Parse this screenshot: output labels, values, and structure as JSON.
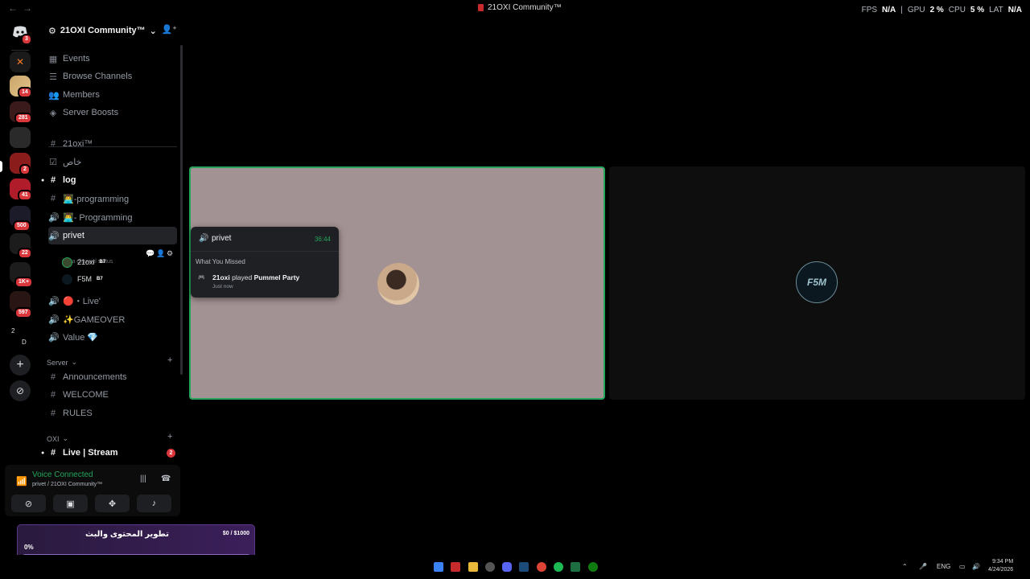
{
  "window": {
    "title": "21OXI Community™",
    "back": "←",
    "forward": "→"
  },
  "perf": {
    "fps_label": "FPS",
    "fps_value": "N/A",
    "gpu_label": "GPU",
    "gpu_value": "2 %",
    "cpu_label": "CPU",
    "cpu_value": "5 %",
    "lat_label": "LAT",
    "lat_value": "N/A"
  },
  "rail": {
    "home_badge": "3",
    "badges": [
      "14",
      "281",
      "2",
      "41",
      "500",
      "22",
      "1K+",
      "597"
    ],
    "folder_labels": [
      "2",
      "D"
    ]
  },
  "server": {
    "name": "21OXI Community™",
    "menu_items": [
      "Events",
      "Browse Channels",
      "Members",
      "Server Boosts"
    ]
  },
  "channels": {
    "c1": "21oxi™",
    "c2": "خاص",
    "c3": "log",
    "c4": "👨‍💻-programming",
    "c5": "👨‍💻- Programming",
    "c6": "privet",
    "c6_status": "Set a channel status",
    "members": [
      {
        "name": "21oxi",
        "tag": "B7"
      },
      {
        "name": "F5M",
        "tag": "B7"
      }
    ],
    "c7": "🔴・Live'",
    "c8": "✨GAMEOVER",
    "c9": "Value 💎",
    "cat1": "Server",
    "c10": "Announcements",
    "c11": "WELCOME",
    "c12": "RULES",
    "cat2": "OXI",
    "c13": "Live | Stream",
    "c13_badge": "2"
  },
  "voice": {
    "status": "Voice Connected",
    "location": "privet / 21OXI Community™"
  },
  "popover": {
    "channel": "privet",
    "time": "36:44",
    "heading": "What You Missed",
    "user": "21oxi",
    "action": "played",
    "game": "Pummel Party",
    "when": "Just now"
  },
  "tiles": {
    "second_avatar_text": "F5M"
  },
  "goal": {
    "title": "تطوير المحتوى والبث",
    "amount": "$0 / $1000",
    "percent_label": "0%",
    "progress": 0
  },
  "taskbar": {
    "lang": "ENG",
    "time": "9:34 PM",
    "date": "4/24/2026"
  },
  "colors": {
    "accent_green": "#23a55a",
    "badge_red": "#da373c",
    "goal_purple": "#3b1f5a"
  }
}
